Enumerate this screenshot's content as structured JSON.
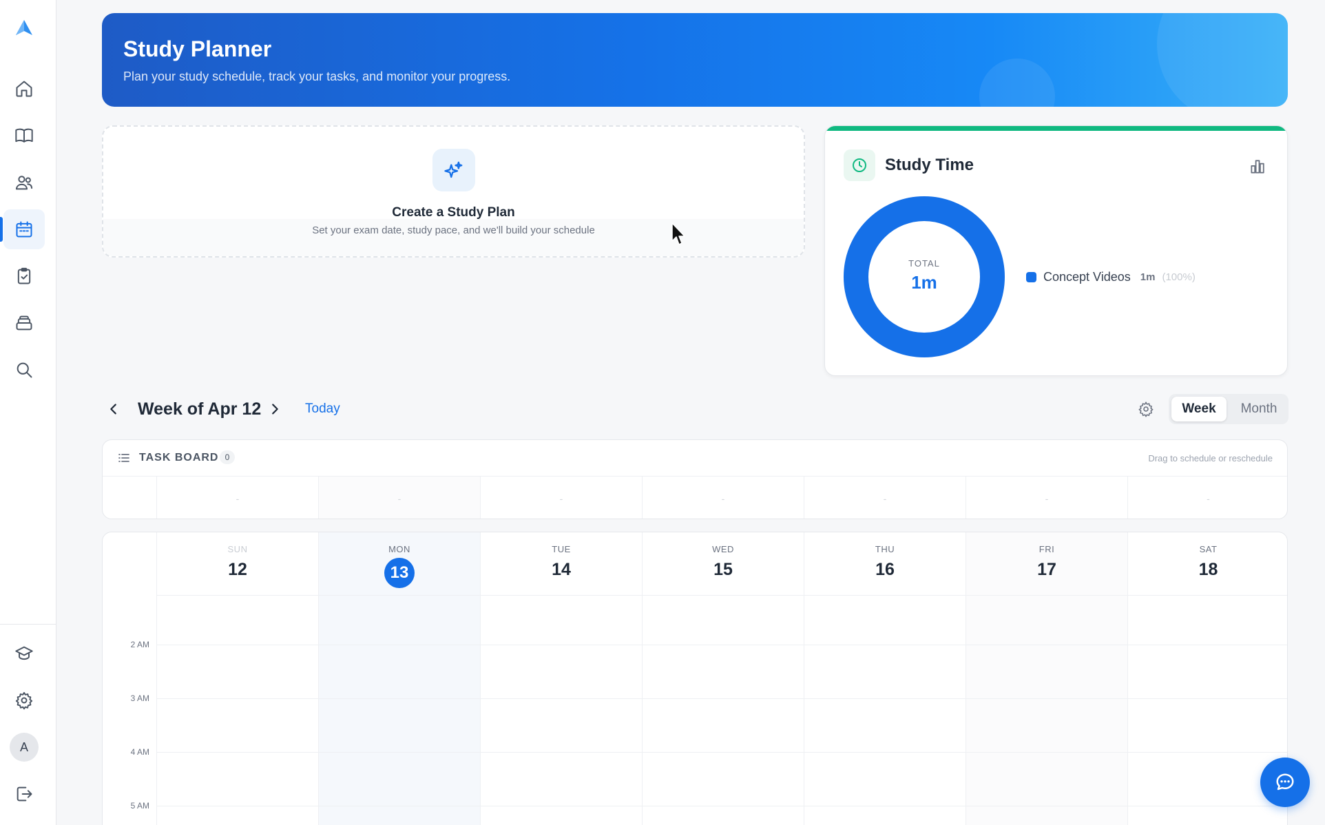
{
  "sidebar": {
    "logo_icon": "logo-triangle-icon",
    "items": [
      {
        "name": "home",
        "icon": "home-icon"
      },
      {
        "name": "library",
        "icon": "book-open-icon"
      },
      {
        "name": "community",
        "icon": "users-icon"
      },
      {
        "name": "planner",
        "icon": "calendar-icon",
        "active": true
      },
      {
        "name": "tasks",
        "icon": "clipboard-check-icon"
      },
      {
        "name": "storage",
        "icon": "archive-icon"
      },
      {
        "name": "search",
        "icon": "search-icon"
      }
    ],
    "bottom": [
      {
        "name": "courses",
        "icon": "graduation-cap-icon"
      },
      {
        "name": "settings",
        "icon": "gear-icon"
      },
      {
        "name": "logout",
        "icon": "logout-icon"
      }
    ],
    "avatar_initial": "A"
  },
  "header": {
    "title": "Study Planner",
    "subtitle": "Plan your study schedule, track your tasks, and monitor your progress."
  },
  "create_plan": {
    "icon": "sparkles-icon",
    "title": "Create a Study Plan",
    "subtitle": "Set your exam date, study pace, and we'll build your schedule"
  },
  "study_time": {
    "icon": "clock-icon",
    "title": "Study Time",
    "chart_icon": "bar-chart-icon",
    "total_label": "TOTAL",
    "total_value": "1m",
    "accent": "#10b981",
    "segments": [
      {
        "name": "Concept Videos",
        "value": "1m",
        "percent": "(100%)",
        "fraction": 1.0,
        "color": "#1570e8"
      }
    ]
  },
  "week_nav": {
    "title": "Week of Apr 12",
    "today_label": "Today",
    "view_options": [
      "Week",
      "Month"
    ],
    "selected_view": "Week"
  },
  "task_board": {
    "title": "TASK BOARD",
    "count": "0",
    "hint": "Drag to schedule or reschedule",
    "cells": [
      "-",
      "-",
      "-",
      "-",
      "-",
      "-",
      "-"
    ]
  },
  "calendar": {
    "days": [
      {
        "dow": "SUN",
        "num": "12"
      },
      {
        "dow": "MON",
        "num": "13",
        "today": true
      },
      {
        "dow": "TUE",
        "num": "14"
      },
      {
        "dow": "WED",
        "num": "15"
      },
      {
        "dow": "THU",
        "num": "16"
      },
      {
        "dow": "FRI",
        "num": "17"
      },
      {
        "dow": "SAT",
        "num": "18"
      }
    ],
    "times": [
      "2 AM",
      "3 AM",
      "4 AM",
      "5 AM"
    ]
  },
  "chat": {
    "icon": "chat-icon"
  },
  "colors": {
    "brand": "#1570e8",
    "success": "#10b981"
  }
}
